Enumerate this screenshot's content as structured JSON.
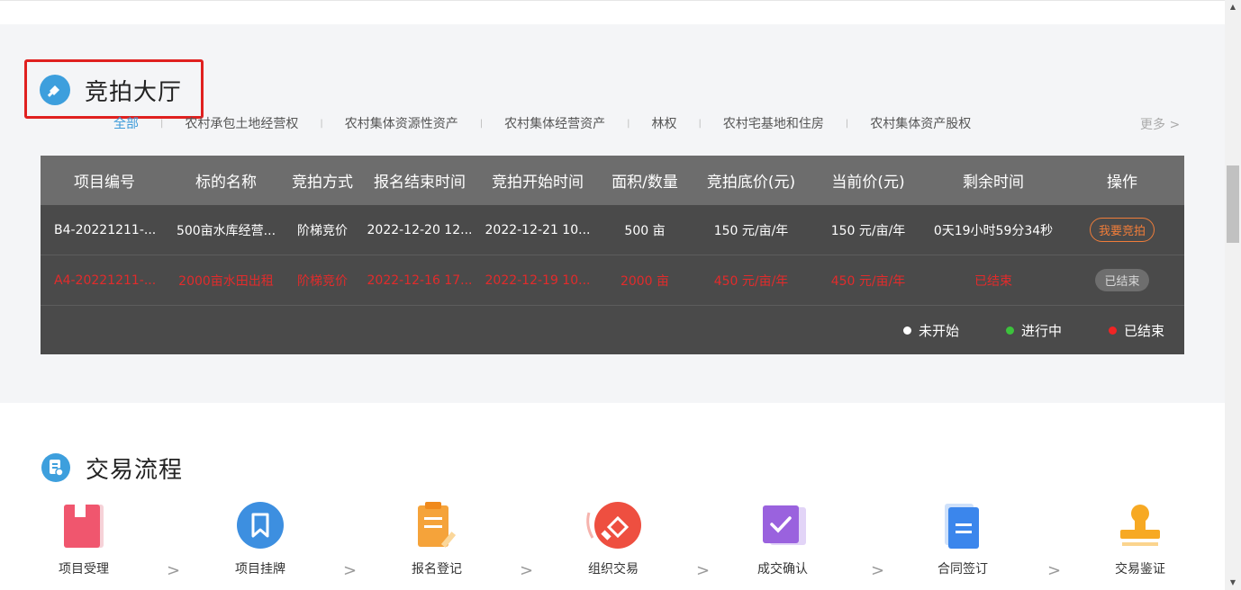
{
  "auction_hall": {
    "title": "竞拍大厅",
    "tabs": [
      "全部",
      "农村承包土地经营权",
      "农村集体资源性资产",
      "农村集体经营资产",
      "林权",
      "农村宅基地和住房",
      "农村集体资产股权"
    ],
    "more": "更多 >",
    "table": {
      "headers": [
        "项目编号",
        "标的名称",
        "竞拍方式",
        "报名结束时间",
        "竞拍开始时间",
        "面积/数量",
        "竞拍底价(元)",
        "当前价(元)",
        "剩余时间",
        "操作"
      ],
      "rows": [
        {
          "id": "B4-20221211-...",
          "name": "500亩水库经营...",
          "method": "阶梯竞价",
          "reg_end": "2022-12-20 12...",
          "start": "2022-12-21 10...",
          "area": "500 亩",
          "base_price": "150 元/亩/年",
          "current_price": "150 元/亩/年",
          "remaining": "0天19小时59分34秒",
          "action": "我要竞拍"
        },
        {
          "id": "A4-20221211-...",
          "name": "2000亩水田出租",
          "method": "阶梯竞价",
          "reg_end": "2022-12-16 17...",
          "start": "2022-12-19 10...",
          "area": "2000 亩",
          "base_price": "450 元/亩/年",
          "current_price": "450 元/亩/年",
          "remaining": "已结束",
          "action": "已结束"
        }
      ],
      "legend": [
        {
          "label": "未开始",
          "color": "#ffffff"
        },
        {
          "label": "进行中",
          "color": "#3cc23c"
        },
        {
          "label": "已结束",
          "color": "#f02424"
        }
      ]
    }
  },
  "trade_flow": {
    "title": "交易流程",
    "steps": [
      {
        "label": "项目受理",
        "icon": "folder-icon",
        "color": "#f0566e"
      },
      {
        "label": "项目挂牌",
        "icon": "bookmark-icon",
        "color": "#3d8fe0"
      },
      {
        "label": "报名登记",
        "icon": "clipboard-icon",
        "color": "#f5a33a"
      },
      {
        "label": "组织交易",
        "icon": "gavel-icon",
        "color": "#ee4f40"
      },
      {
        "label": "成交确认",
        "icon": "check-box-icon",
        "color": "#9a62de"
      },
      {
        "label": "合同签订",
        "icon": "document-icon",
        "color": "#3b86ec"
      },
      {
        "label": "交易鉴证",
        "icon": "stamp-icon",
        "color": "#f7a923"
      }
    ]
  },
  "colors": {
    "accent": "#3d9fdd",
    "highlight_box": "#e0201f",
    "ended_text": "#e22b2b",
    "bid_button": "#f07d3a"
  }
}
